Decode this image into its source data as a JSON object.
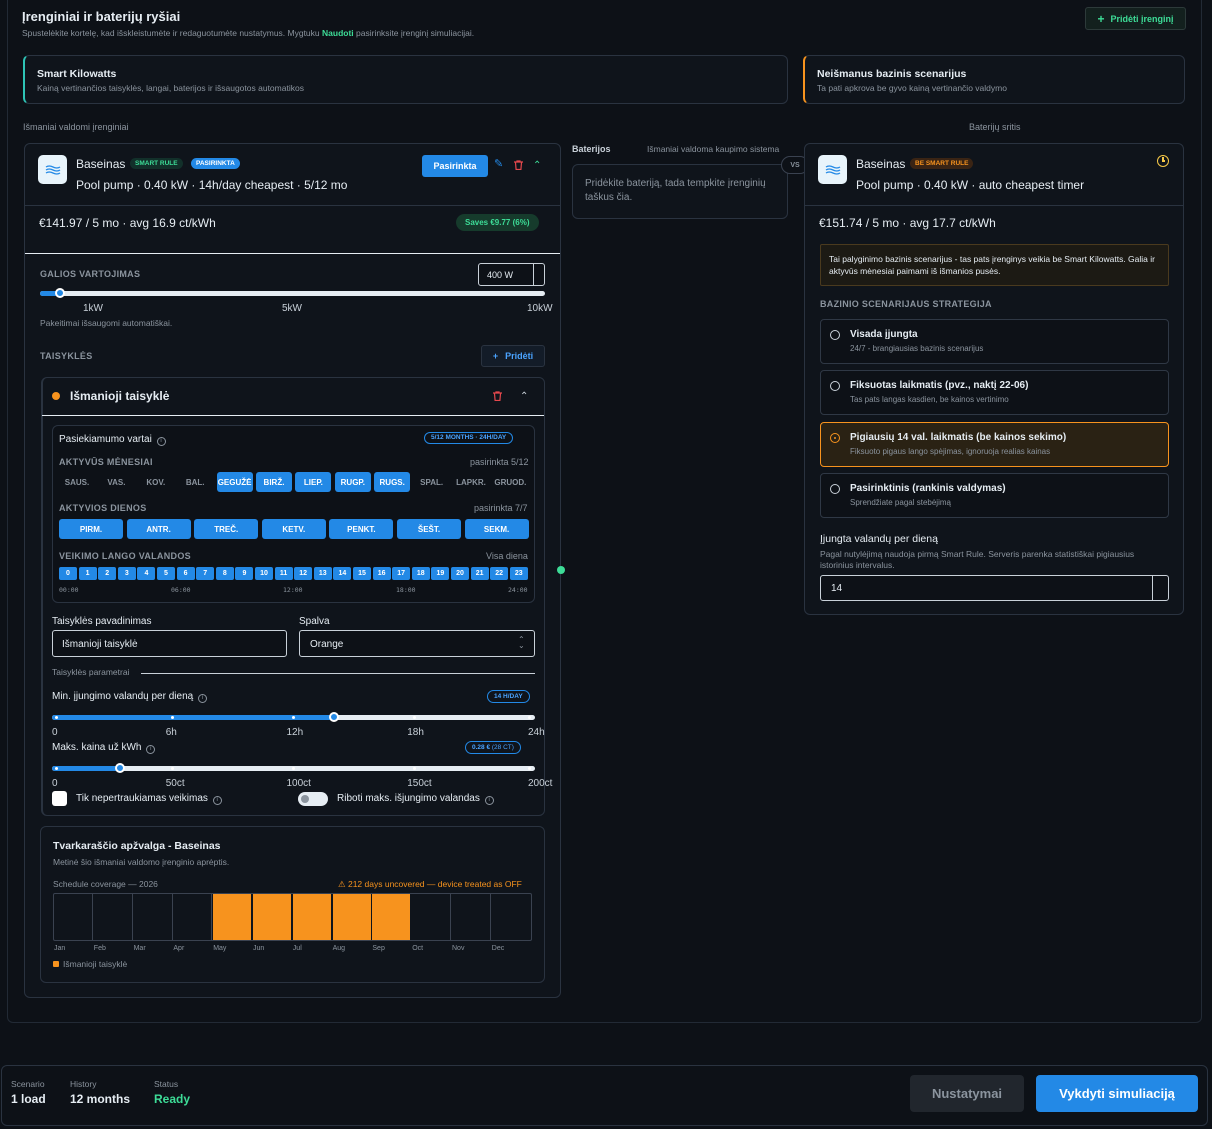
{
  "header": {
    "title": "Įrenginiai ir baterijų ryšiai",
    "subtitle_pre": "Spustelėkite kortelę, kad išskleistumėte ir redaguotumėte nustatymus. Mygtuku ",
    "subtitle_link": "Naudoti",
    "subtitle_post": " pasirinksite įrenginį simuliacijai.",
    "add_device": "Pridėti įrenginį"
  },
  "scenarios": {
    "smart": {
      "title": "Smart Kilowatts",
      "desc": "Kainą vertinančios taisyklės, langai, baterijos ir išsaugotos automatikos"
    },
    "baseline": {
      "title": "Neišmanus bazinis scenarijus",
      "desc": "Ta pati apkrova be gyvo kainą vertinančio valdymo"
    }
  },
  "columns": {
    "smart_label": "Išmaniai valdomi įrenginiai",
    "battery_area": "Baterijų sritis",
    "batteries": "Baterijos",
    "storage": "Išmaniai valdoma kaupimo sistema",
    "battery_hint": "Pridėkite bateriją, tada tempkite įrenginių taškus čia.",
    "vs": "VS"
  },
  "device": {
    "name": "Baseinas",
    "badge_smart": "SMART RULE",
    "badge_selected": "PASIRINKTA",
    "selected_btn": "Pasirinkta",
    "summary": "Pool pump · 0.40 kW · 14h/day cheapest · 5/12 mo",
    "cost": "€141.97",
    "cost_detail": " / 5 mo · avg 16.9 ct/kWh",
    "saves": "Saves €9.77 (6%)",
    "power_label": "GALIOS VARTOJIMAS",
    "power_value": "400 W",
    "power_fraction": 0.04,
    "power_ticks": [
      "1kW",
      "5kW",
      "10kW"
    ],
    "autosave": "Pakeitimai išsaugomi automatiškai.",
    "rules_label": "TAISYKLĖS",
    "add_rule": "Pridėti",
    "rule": {
      "name": "Išmanioji taisyklė",
      "color": "#f7931e",
      "season_title": "Pasiekiamumo vartai",
      "season_badge": "5/12 MONTHS · 24H/DAY",
      "months_label": "AKTYVŪS MĖNESIAI",
      "months_count": "pasirinkta 5/12",
      "months": [
        {
          "l": "SAUS.",
          "on": false
        },
        {
          "l": "VAS.",
          "on": false
        },
        {
          "l": "KOV.",
          "on": false
        },
        {
          "l": "BAL.",
          "on": false
        },
        {
          "l": "GEGUŽĖ",
          "on": true
        },
        {
          "l": "BIRŽ.",
          "on": true
        },
        {
          "l": "LIEP.",
          "on": true
        },
        {
          "l": "RUGP.",
          "on": true
        },
        {
          "l": "RUGS.",
          "on": true
        },
        {
          "l": "SPAL.",
          "on": false
        },
        {
          "l": "LAPKR.",
          "on": false
        },
        {
          "l": "GRUOD.",
          "on": false
        }
      ],
      "days_label": "AKTYVIOS DIENOS",
      "days_count": "pasirinkta 7/7",
      "days": [
        "PIRM.",
        "ANTR.",
        "TREČ.",
        "KETV.",
        "PENKT.",
        "ŠEŠT.",
        "SEKM."
      ],
      "hours_label": "VEIKIMO LANGO VALANDOS",
      "hours_mode": "Visa diena",
      "hours": [
        "0",
        "1",
        "2",
        "3",
        "4",
        "5",
        "6",
        "7",
        "8",
        "9",
        "10",
        "11",
        "12",
        "13",
        "14",
        "15",
        "16",
        "17",
        "18",
        "19",
        "20",
        "21",
        "22",
        "23"
      ],
      "hour_ticks": [
        "00:00",
        "06:00",
        "12:00",
        "18:00",
        "24:00"
      ],
      "name_label": "Taisyklės pavadinimas",
      "name_value": "Išmanioji taisyklė",
      "color_label": "Spalva",
      "color_value": "Orange",
      "params_label": "Taisyklės parametrai",
      "min_hours_label": "Min. įjungimo valandų per dieną",
      "min_hours_badge": "14 H/DAY",
      "min_hours_value": 14,
      "min_hours_max": 24,
      "min_hours_ticks": [
        "0",
        "6h",
        "12h",
        "18h",
        "24h"
      ],
      "max_price_label": "Maks. kaina už kWh",
      "max_price_badge": "0.28 €",
      "max_price_badge2": " (28 CT)",
      "max_price_value": 28,
      "max_price_max": 200,
      "max_price_ticks": [
        "0",
        "50ct",
        "100ct",
        "150ct",
        "200ct"
      ],
      "continuous": "Tik nepertraukiamas veikimas",
      "limit_off": "Riboti maks. išjungimo valandas"
    },
    "schedule": {
      "title": "Tvarkaraščio apžvalga - Baseinas",
      "desc": "Metinė šio išmaniai valdomo įrenginio aprėptis.",
      "coverage": "Schedule coverage — 2026",
      "warning": "⚠ 212 days uncovered — device treated as OFF",
      "months": [
        "Jan",
        "Feb",
        "Mar",
        "Apr",
        "May",
        "Jun",
        "Jul",
        "Aug",
        "Sep",
        "Oct",
        "Nov",
        "Dec"
      ],
      "covered": [
        false,
        false,
        false,
        false,
        true,
        true,
        true,
        true,
        true,
        false,
        false,
        false
      ],
      "legend": "Išmanioji taisyklė"
    }
  },
  "baseline_device": {
    "name": "Baseinas",
    "badge": "BE SMART RULE",
    "summary": "Pool pump · 0.40 kW · auto cheapest timer",
    "cost": "€151.74",
    "cost_detail": " / 5 mo · avg 17.7 ct/kWh",
    "note": "Tai palyginimo bazinis scenarijus - tas pats įrenginys veikia be Smart Kilowatts. Galia ir aktyvūs mėnesiai paimami iš išmanios pusės.",
    "strategy_label": "BAZINIO SCENARIJAUS STRATEGIJA",
    "options": [
      {
        "t": "Visada įjungta",
        "d": "24/7 - brangiausias bazinis scenarijus",
        "sel": false
      },
      {
        "t": "Fiksuotas laikmatis (pvz., naktį 22-06)",
        "d": "Tas pats langas kasdien, be kainos vertinimo",
        "sel": false
      },
      {
        "t": "Pigiausių 14 val. laikmatis (be kainos sekimo)",
        "d": "Fiksuoto pigaus lango spėjimas, ignoruoja realias kainas",
        "sel": true
      },
      {
        "t": "Pasirinktinis (rankinis valdymas)",
        "d": "Sprendžiate pagal stebėjimą",
        "sel": false
      }
    ],
    "hours_label": "Įjungta valandų per dieną",
    "hours_desc": "Pagal nutylėjimą naudoja pirmą Smart Rule. Serveris parenka statistiškai pigiausius istorinius intervalus.",
    "hours_value": "14"
  },
  "footer": {
    "scenario_label": "Scenario",
    "scenario_value": "1 load",
    "history_label": "History",
    "history_value": "12 months",
    "status_label": "Status",
    "status_value": "Ready",
    "settings": "Nustatymai",
    "run": "Vykdyti simuliaciją"
  }
}
